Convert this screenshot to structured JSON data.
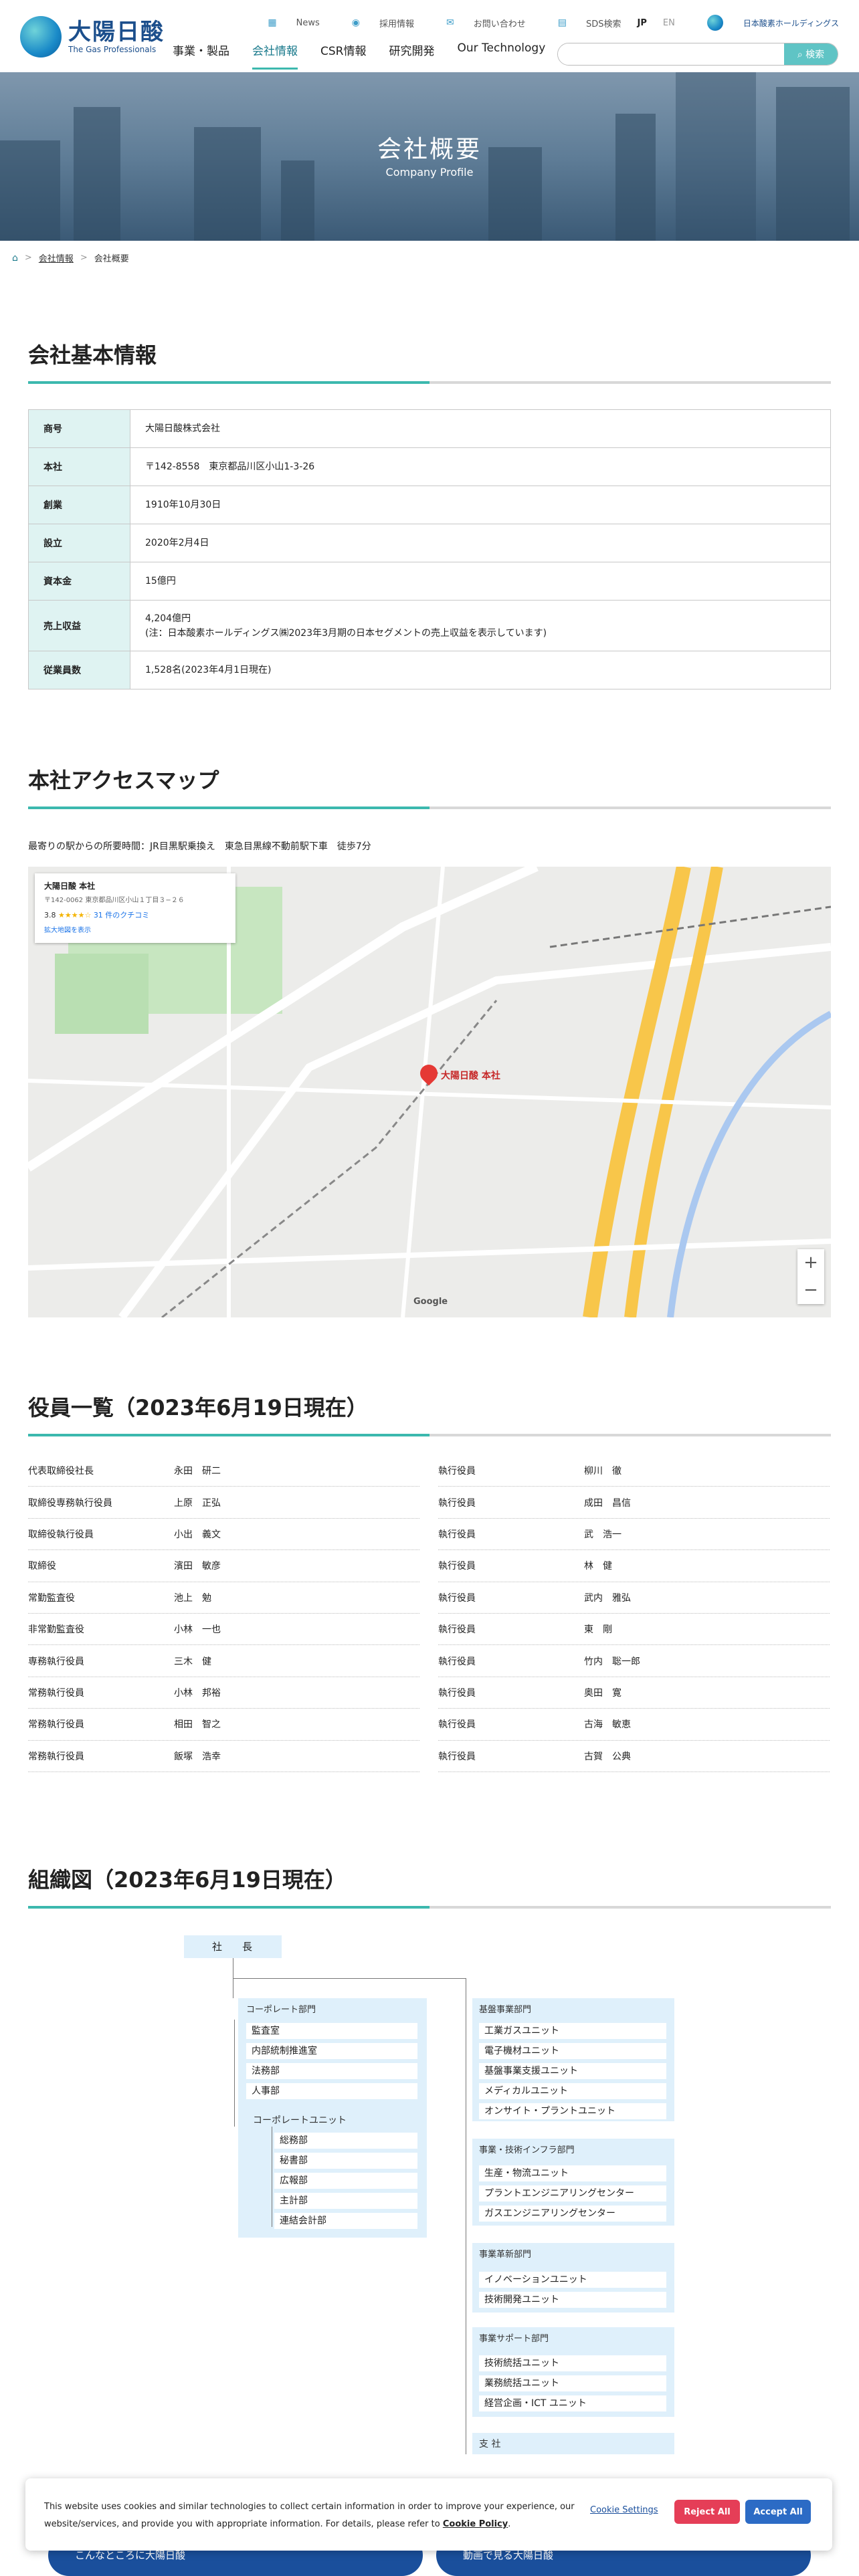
{
  "header": {
    "logo_name": "大陽日酸",
    "logo_sub": "The Gas Professionals",
    "nav": [
      "事業・製品",
      "会社情報",
      "CSR情報",
      "研究開発",
      "Our Technology"
    ],
    "util": {
      "news": "News",
      "recruit": "採用情報",
      "contact": "お問い合わせ",
      "sds": "SDS検索",
      "lang_jp": "JP",
      "lang_en": "EN",
      "holdings": "日本酸素ホールディングス"
    },
    "search_button": "検索"
  },
  "hero": {
    "title": "会社概要",
    "subtitle": "Company Profile"
  },
  "breadcrumb": {
    "home_icon": "home-icon",
    "items": [
      "会社情報",
      "会社概要"
    ]
  },
  "basic_info": {
    "title": "会社基本情報",
    "rows": [
      {
        "label": "商号",
        "value": "大陽日酸株式会社"
      },
      {
        "label": "本社",
        "value": "〒142-8558　東京都品川区小山1-3-26"
      },
      {
        "label": "創業",
        "value": "1910年10月30日"
      },
      {
        "label": "設立",
        "value": "2020年2月4日"
      },
      {
        "label": "資本金",
        "value": "15億円"
      },
      {
        "label": "売上収益",
        "value": "4,204億円",
        "note": "(注：日本酸素ホールディングス㈱2023年3月期の日本セグメントの売上収益を表示しています)"
      },
      {
        "label": "従業員数",
        "value": "1,528名(2023年4月1日現在)"
      }
    ]
  },
  "access": {
    "title": "本社アクセスマップ",
    "text": "最寄りの駅からの所要時間：JR目黒駅乗換え　東急目黒線不動前駅下車　徒歩7分",
    "map": {
      "card_title": "大陽日酸 本社",
      "card_address": "〒142-0062 東京都品川区小山１丁目３−２６",
      "card_rating": "3.8",
      "card_stars": "★★★★☆",
      "card_reviews": "31 件のクチコミ",
      "card_link": "拡大地図を表示",
      "pin_label": "大陽日酸 本社",
      "zoom_in": "+",
      "zoom_out": "−",
      "google": "Google"
    }
  },
  "officers": {
    "title": "役員一覧（2023年6月19日現在）",
    "left": [
      {
        "role": "代表取締役社長",
        "name": "永田　研二"
      },
      {
        "role": "取締役専務執行役員",
        "name": "上原　正弘"
      },
      {
        "role": "取締役執行役員",
        "name": "小出　義文"
      },
      {
        "role": "取締役",
        "name": "濱田　敏彦"
      },
      {
        "role": "常勤監査役",
        "name": "池上　勉"
      },
      {
        "role": "非常勤監査役",
        "name": "小林　一也"
      },
      {
        "role": "専務執行役員",
        "name": "三木　健"
      },
      {
        "role": "常務執行役員",
        "name": "小林　邦裕"
      },
      {
        "role": "常務執行役員",
        "name": "相田　智之"
      },
      {
        "role": "常務執行役員",
        "name": "飯塚　浩幸"
      }
    ],
    "right": [
      {
        "role": "執行役員",
        "name": "柳川　徹"
      },
      {
        "role": "執行役員",
        "name": "成田　昌信"
      },
      {
        "role": "執行役員",
        "name": "武　浩一"
      },
      {
        "role": "執行役員",
        "name": "林　健"
      },
      {
        "role": "執行役員",
        "name": "武内　雅弘"
      },
      {
        "role": "執行役員",
        "name": "東　剛"
      },
      {
        "role": "執行役員",
        "name": "竹内　聡一郎"
      },
      {
        "role": "執行役員",
        "name": "奥田　寛"
      },
      {
        "role": "執行役員",
        "name": "古海　敏恵"
      },
      {
        "role": "執行役員",
        "name": "古賀　公典"
      }
    ]
  },
  "org": {
    "title": "組織図（2023年6月19日現在）",
    "ceo": "社長",
    "corporate": {
      "title": "コーポレート部門",
      "units": [
        "監査室",
        "内部統制推進室",
        "法務部",
        "人事部"
      ],
      "sub_title": "コーポレートユニット",
      "sub_units": [
        "総務部",
        "秘書部",
        "広報部",
        "主計部",
        "連結会計部"
      ]
    },
    "groups": [
      {
        "title": "基盤事業部門",
        "units": [
          "工業ガスユニット",
          "電子機材ユニット",
          "基盤事業支援ユニット",
          "メディカルユニット",
          "オンサイト・プラントユニット"
        ]
      },
      {
        "title": "事業・技術インフラ部門",
        "units": [
          "生産・物流ユニット",
          "プラントエンジニアリングセンター",
          "ガスエンジニアリングセンター"
        ]
      },
      {
        "title": "事業革新部門",
        "units": [
          "イノベーションユニット",
          "技術開発ユニット"
        ]
      },
      {
        "title": "事業サポート部門",
        "units": [
          "技術統括ユニット",
          "業務統括ユニット",
          "経営企画・ICT ユニット"
        ]
      }
    ],
    "branch": "支 社"
  },
  "bottom_buttons": [
    "こんなところに大陽日酸",
    "動画で見る大陽日酸"
  ],
  "cookie": {
    "text": "This website uses cookies and similar technologies to collect certain information in order to improve your experience, our website/services, and provide you with appropriate information. For details, please refer to ",
    "policy": "Cookie Policy",
    "settings": "Cookie Settings",
    "reject": "Reject All",
    "accept": "Accept All"
  }
}
